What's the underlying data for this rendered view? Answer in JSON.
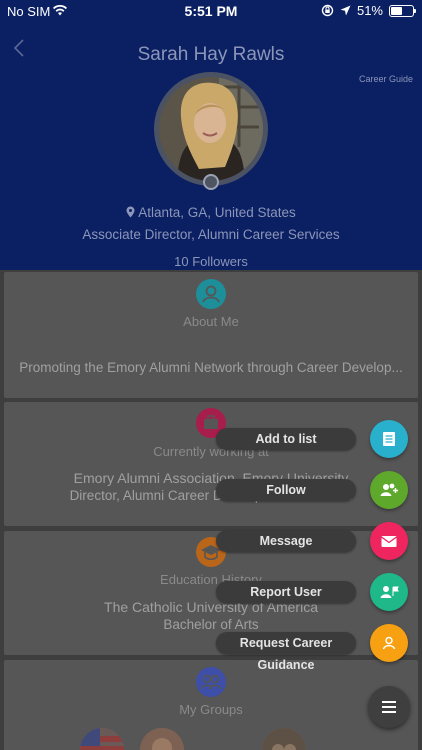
{
  "status_bar": {
    "carrier": "No SIM",
    "time": "5:51 PM",
    "battery_percent": "51%",
    "battery_level": 0.51
  },
  "profile": {
    "name": "Sarah Hay Rawls",
    "career_guide_label": "Career Guide",
    "location": "Atlanta, GA, United States",
    "title": "Associate Director, Alumni Career Services",
    "followers": "10 Followers"
  },
  "about": {
    "heading": "About Me",
    "text": "Promoting the Emory Alumni Network through Career Develop..."
  },
  "work": {
    "heading": "Currently working at",
    "organization": "Emory Alumni Association, Emory University",
    "position": "Director, Alumni Career Development Networks"
  },
  "education": {
    "heading": "Education History",
    "school": "The Catholic University of America",
    "degree": "Bachelor of Arts"
  },
  "groups": {
    "heading": "My Groups"
  },
  "fab_menu": {
    "add_to_list": "Add to list",
    "follow": "Follow",
    "message": "Message",
    "report_user": "Report User",
    "request_career_guidance": "Request Career Guidance"
  },
  "colors": {
    "header_bg": "#0b1f63",
    "fab_add_to_list": "#29b0cc",
    "fab_follow": "#5ea82c",
    "fab_message": "#ef2560",
    "fab_report": "#1fb889",
    "fab_guidance": "#f7a012",
    "about_icon": "#1d8f9a",
    "work_icon": "#a71d4b",
    "education_icon": "#b9651a",
    "groups_icon": "#3d4fa8"
  },
  "icons": {
    "back": "chevron-left-icon",
    "wifi": "wifi-icon",
    "location": "map-pin-icon",
    "about": "person-icon",
    "work": "briefcase-icon",
    "education": "graduation-cap-icon",
    "groups": "group-icon",
    "add_to_list": "list-icon",
    "follow": "add-people-icon",
    "message": "envelope-icon",
    "report": "report-user-icon",
    "guidance": "person-icon",
    "menu": "hamburger-icon"
  }
}
